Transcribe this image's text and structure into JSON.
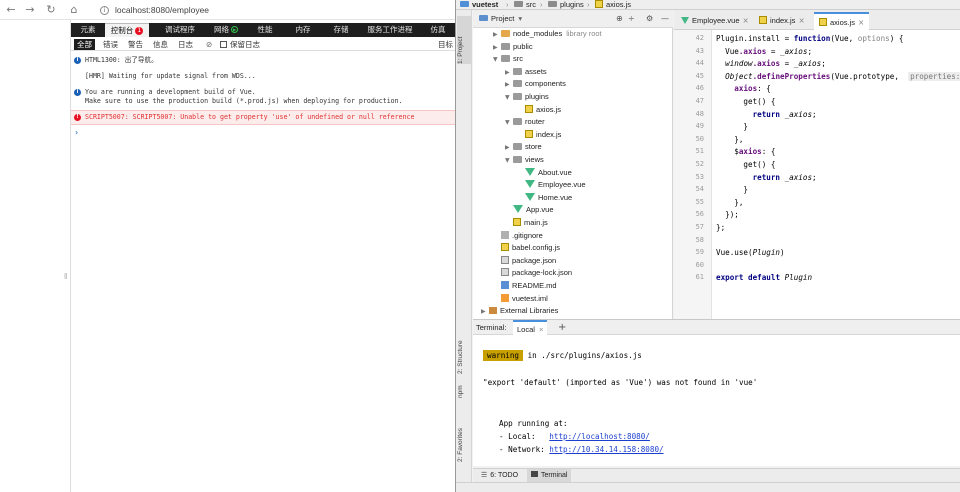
{
  "browser": {
    "url": "localhost:8080/employee",
    "nav_icons": [
      "back-icon",
      "forward-icon",
      "refresh-icon",
      "home-icon",
      "info-icon"
    ]
  },
  "devtools": {
    "tabs": [
      {
        "label": "元素"
      },
      {
        "label": "控制台",
        "badge": "1"
      },
      {
        "label": "调试程序"
      },
      {
        "label": "网络"
      },
      {
        "label": "性能"
      },
      {
        "label": "内存"
      },
      {
        "label": "存储"
      },
      {
        "label": "服务工作进程"
      },
      {
        "label": "仿真"
      }
    ],
    "filters": [
      "全部",
      "错误",
      "警告",
      "信息",
      "日志"
    ],
    "preserve_log": "保留日志",
    "right_label": "目标",
    "console_lines": [
      {
        "type": "info",
        "text": "HTML1300: 出了导航。"
      },
      {
        "type": "plain",
        "text": "[HMR] Waiting for update signal from WDS..."
      },
      {
        "type": "info",
        "text": "You are running a development build of Vue."
      },
      {
        "type": "plain",
        "text": "Make sure to use the production build (*.prod.js) when deploying for production."
      },
      {
        "type": "error",
        "text": "SCRIPT5007: SCRIPT5007: Unable to get property 'use' of undefined or null reference"
      }
    ],
    "prompt": "›"
  },
  "ide": {
    "breadcrumb": [
      "vuetest",
      "src",
      "plugins",
      "axios.js"
    ],
    "left_tool_tabs": [
      "1: Project",
      "2: Structure",
      "npm",
      "2: Favorites"
    ],
    "project_header": "Project",
    "tree": [
      {
        "label": "node_modules",
        "note": "library root",
        "indent": 1,
        "arrow": "▶",
        "icon": "folder exc"
      },
      {
        "label": "public",
        "indent": 1,
        "arrow": "▶",
        "icon": "folder"
      },
      {
        "label": "src",
        "indent": 1,
        "arrow": "▼",
        "icon": "folder"
      },
      {
        "label": "assets",
        "indent": 2,
        "arrow": "▶",
        "icon": "folder"
      },
      {
        "label": "components",
        "indent": 2,
        "arrow": "▶",
        "icon": "folder"
      },
      {
        "label": "plugins",
        "indent": 2,
        "arrow": "▼",
        "icon": "folder"
      },
      {
        "label": "axios.js",
        "indent": 3,
        "arrow": "",
        "icon": "js"
      },
      {
        "label": "router",
        "indent": 2,
        "arrow": "▼",
        "icon": "folder"
      },
      {
        "label": "index.js",
        "indent": 3,
        "arrow": "",
        "icon": "js"
      },
      {
        "label": "store",
        "indent": 2,
        "arrow": "▶",
        "icon": "folder"
      },
      {
        "label": "views",
        "indent": 2,
        "arrow": "▼",
        "icon": "folder"
      },
      {
        "label": "About.vue",
        "indent": 3,
        "arrow": "",
        "icon": "vue"
      },
      {
        "label": "Employee.vue",
        "indent": 3,
        "arrow": "",
        "icon": "vue"
      },
      {
        "label": "Home.vue",
        "indent": 3,
        "arrow": "",
        "icon": "vue"
      },
      {
        "label": "App.vue",
        "indent": 2,
        "arrow": "",
        "icon": "vue"
      },
      {
        "label": "main.js",
        "indent": 2,
        "arrow": "",
        "icon": "js"
      },
      {
        "label": ".gitignore",
        "indent": 1,
        "arrow": "",
        "icon": "git"
      },
      {
        "label": "babel.config.js",
        "indent": 1,
        "arrow": "",
        "icon": "js"
      },
      {
        "label": "package.json",
        "indent": 1,
        "arrow": "",
        "icon": "json"
      },
      {
        "label": "package-lock.json",
        "indent": 1,
        "arrow": "",
        "icon": "json"
      },
      {
        "label": "README.md",
        "indent": 1,
        "arrow": "",
        "icon": "md"
      },
      {
        "label": "vuetest.iml",
        "indent": 1,
        "arrow": "",
        "icon": "xml"
      },
      {
        "label": "External Libraries",
        "indent": 0,
        "arrow": "▶",
        "icon": "lib"
      }
    ],
    "editor_tabs": [
      {
        "label": "Employee.vue",
        "icon": "vue"
      },
      {
        "label": "index.js",
        "icon": "js"
      },
      {
        "label": "axios.js",
        "icon": "js",
        "active": true
      }
    ],
    "code_line_numbers": [
      "42",
      "43",
      "44",
      "45",
      "46",
      "47",
      "48",
      "49",
      "50",
      "51",
      "52",
      "53",
      "54",
      "55",
      "56",
      "57",
      "58",
      "59",
      "60",
      "61"
    ],
    "code_lines": [
      "",
      "Plugin.install = function(Vue, options) {",
      "  Vue.axios = _axios;",
      "  window.axios = _axios;",
      "  Object.defineProperties(Vue.prototype,  properties: {",
      "    axios: {",
      "      get() {",
      "        return _axios;",
      "      }",
      "    },",
      "    $axios: {",
      "      get() {",
      "        return _axios;",
      "      }",
      "    },",
      "  });",
      "};",
      "",
      "Vue.use(Plugin)",
      "",
      "export default Plugin"
    ],
    "terminal": {
      "tabs": [
        "Terminal:",
        "Local"
      ],
      "warning_badge": "warning",
      "warning_text": " in ./src/plugins/axios.js",
      "export_msg": "\"export 'default' (imported as 'Vue') was not found in 'vue'",
      "app_running": "App running at:",
      "local_label": "- Local:   ",
      "local_url": "http://localhost:8080/",
      "network_label": "- Network: ",
      "network_url": "http://10.34.14.158:8080/"
    },
    "bottom_tabs": [
      "6: TODO",
      "Terminal"
    ]
  }
}
